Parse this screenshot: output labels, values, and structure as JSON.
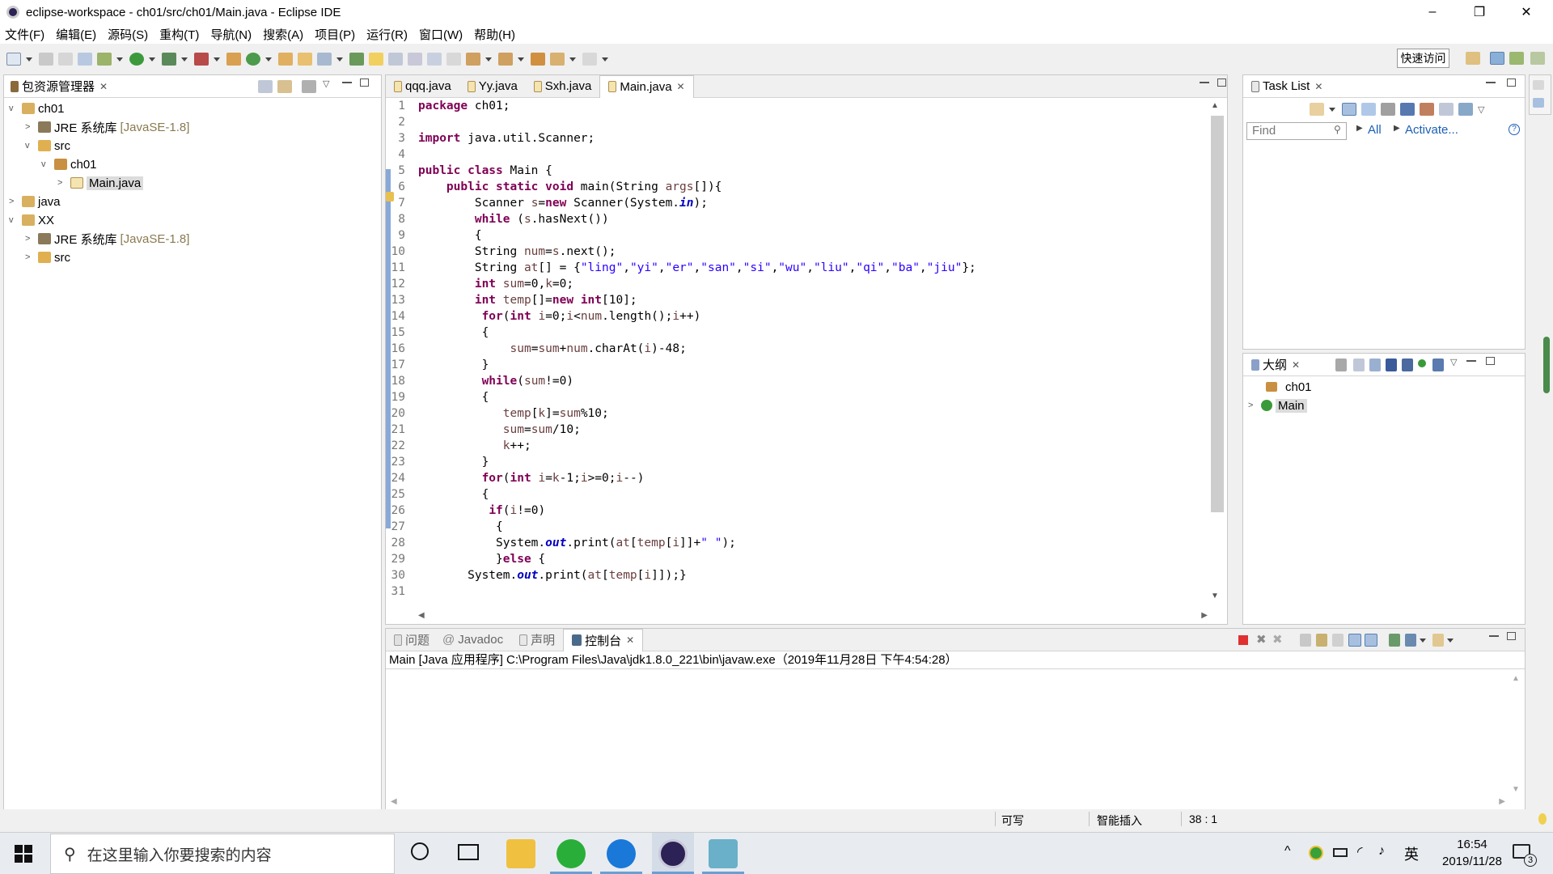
{
  "window": {
    "title": "eclipse-workspace - ch01/src/ch01/Main.java - Eclipse IDE",
    "minimize": "–",
    "restore": "❐",
    "close": "✕"
  },
  "menu": [
    "文件(F)",
    "编辑(E)",
    "源码(S)",
    "重构(T)",
    "导航(N)",
    "搜索(A)",
    "项目(P)",
    "运行(R)",
    "窗口(W)",
    "帮助(H)"
  ],
  "toolbar": {
    "quick_access": "快速访问"
  },
  "package_explorer": {
    "tab": "包资源管理器",
    "tree": [
      {
        "label": "ch01",
        "extra": ""
      },
      {
        "label": "JRE 系统库",
        "extra": "[JavaSE-1.8]"
      },
      {
        "label": "src",
        "extra": ""
      },
      {
        "label": "ch01",
        "extra": ""
      },
      {
        "label": "Main.java",
        "extra": ""
      },
      {
        "label": "java",
        "extra": ""
      },
      {
        "label": "XX",
        "extra": ""
      },
      {
        "label": "JRE 系统库",
        "extra": "[JavaSE-1.8]"
      },
      {
        "label": "src",
        "extra": ""
      }
    ]
  },
  "editor": {
    "tabs": [
      "qqq.java",
      "Yy.java",
      "Sxh.java",
      "Main.java"
    ],
    "line_numbers": [
      "1",
      "2",
      "3",
      "4",
      "5",
      "6",
      "7",
      "8",
      "9",
      "10",
      "11",
      "12",
      "13",
      "14",
      "15",
      "16",
      "17",
      "18",
      "19",
      "20",
      "21",
      "22",
      "23",
      "24",
      "25",
      "26",
      "27",
      "28",
      "29",
      "30",
      "31"
    ]
  },
  "task_list": {
    "tab": "Task List",
    "find_placeholder": "Find",
    "all": "All",
    "activate": "Activate..."
  },
  "outline": {
    "tab": "大纲",
    "items": [
      "ch01",
      "Main"
    ]
  },
  "console": {
    "tabs": [
      "问题",
      "Javadoc",
      "声明",
      "控制台"
    ],
    "header": "Main [Java 应用程序] C:\\Program Files\\Java\\jdk1.8.0_221\\bin\\javaw.exe（2019年11月28日 下午4:54:28）"
  },
  "status": {
    "writable": "可写",
    "insert_mode": "智能插入",
    "position": "38 : 1"
  },
  "taskbar": {
    "search_placeholder": "在这里输入你要搜索的内容",
    "ime": "英",
    "time": "16:54",
    "date": "2019/11/28",
    "notifications": "3"
  },
  "colors": {
    "keyword": "#7f0055",
    "string": "#2a00ff",
    "field": "#0000c0",
    "accent": "#6a9fd4"
  }
}
